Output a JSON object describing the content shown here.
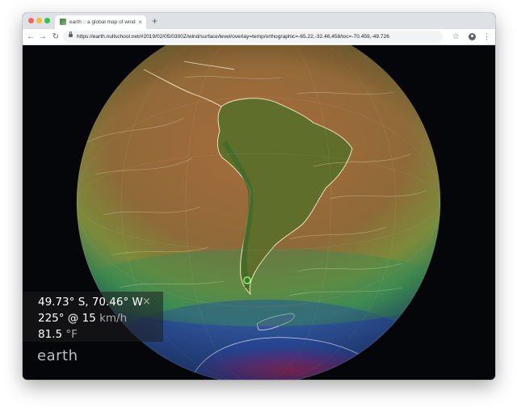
{
  "browser": {
    "tab_title": "earth :: a global map of wind, w",
    "tab_close": "×",
    "new_tab": "+",
    "url": "https://earth.nullschool.net/#2019/02/05/0300Z/wind/surface/level/overlay=temp/orthographic=-65.22,-32.46,458/loc=-70.459,-49.726",
    "back": "←",
    "forward": "→",
    "reload": "↻",
    "star": "☆",
    "menu": "⋮"
  },
  "info_panel": {
    "location": "49.73° S, 70.46° W",
    "close": "×",
    "wind_value": "225° @ 15",
    "wind_unit": "km/h",
    "temp_value": "81.5",
    "temp_unit": "°F"
  },
  "brand": "earth",
  "colors": {
    "ocean_warm": "#9c6a3c",
    "ocean_mid": "#7a8a3a",
    "ocean_cool": "#3d8a5a",
    "cold": "#2b4fa0",
    "very_cold": "#a0306a",
    "background": "#05060a"
  }
}
